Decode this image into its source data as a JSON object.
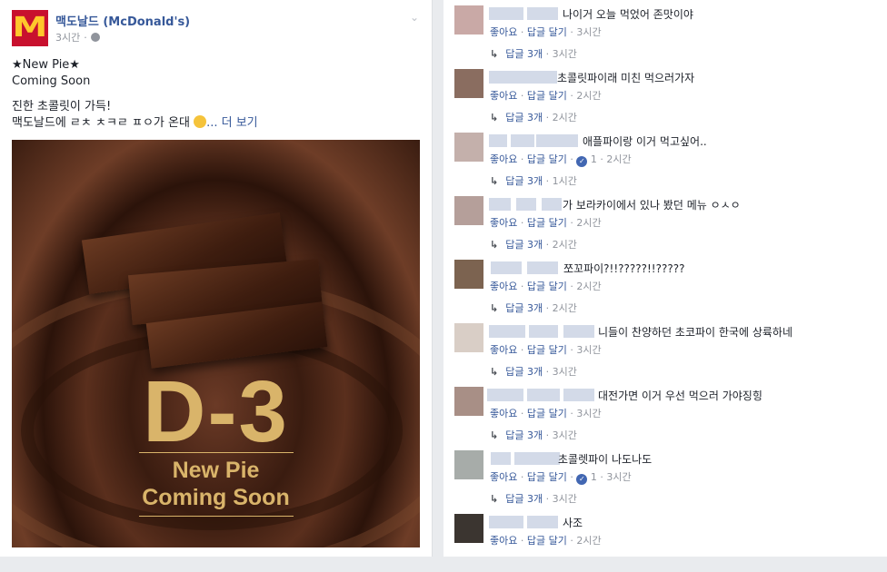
{
  "post": {
    "page_name": "맥도날드 (McDonald's)",
    "time": "3시간",
    "line1": "★New Pie★",
    "line2": "Coming Soon",
    "line3": "진한 초콜릿이 가득!",
    "line4": "맥도날드에 ㄹㅊ ㅊㅋㄹ ㅍㅇ가 온대",
    "see_more": "... 더 보기",
    "image_text": {
      "big": "D-3",
      "sub1": "New Pie",
      "sub2": "Coming Soon"
    }
  },
  "actions": {
    "like": "좋아요",
    "reply": "답글 달기",
    "sep": "·"
  },
  "comments": [
    {
      "text": "나이거 오늘 먹었어 존맛이야",
      "time": "3시간",
      "likes": "",
      "replies": "답글 3개",
      "reply_time": "3시간",
      "avatar": "#c9a9a6"
    },
    {
      "text": "초콜릿파이래 미친 먹으러가자",
      "time": "2시간",
      "likes": "",
      "replies": "답글 3개",
      "reply_time": "2시간",
      "avatar": "#8a6d60"
    },
    {
      "text": "애플파이랑 이거 먹고싶어..",
      "time": "2시간",
      "likes": "1",
      "replies": "답글 3개",
      "reply_time": "1시간",
      "avatar": "#c4b0ab"
    },
    {
      "text": "가 보라카이에서 있나 봤던 메뉴 ㅇㅅㅇ",
      "time": "2시간",
      "likes": "",
      "replies": "답글 3개",
      "reply_time": "2시간",
      "avatar": "#b59f9a"
    },
    {
      "text": "쪼꼬파이?!!?????!!?????",
      "time": "2시간",
      "likes": "",
      "replies": "답글 3개",
      "reply_time": "2시간",
      "avatar": "#7c6350"
    },
    {
      "text": "니들이 찬양하던 초코파이 한국에 상륙하네",
      "time": "3시간",
      "likes": "",
      "replies": "답글 3개",
      "reply_time": "3시간",
      "avatar": "#d9cec6"
    },
    {
      "text": "대전가면 이거 우선 먹으러 가야징힝",
      "time": "3시간",
      "likes": "",
      "replies": "답글 3개",
      "reply_time": "3시간",
      "avatar": "#a88f86"
    },
    {
      "text": "초콜렛파이 나도나도",
      "time": "3시간",
      "likes": "1",
      "replies": "답글 3개",
      "reply_time": "3시간",
      "avatar": "#a7aca9"
    },
    {
      "text": "사조",
      "time": "2시간",
      "likes": "",
      "replies": "",
      "reply_time": "",
      "avatar": "#3b3530"
    }
  ]
}
